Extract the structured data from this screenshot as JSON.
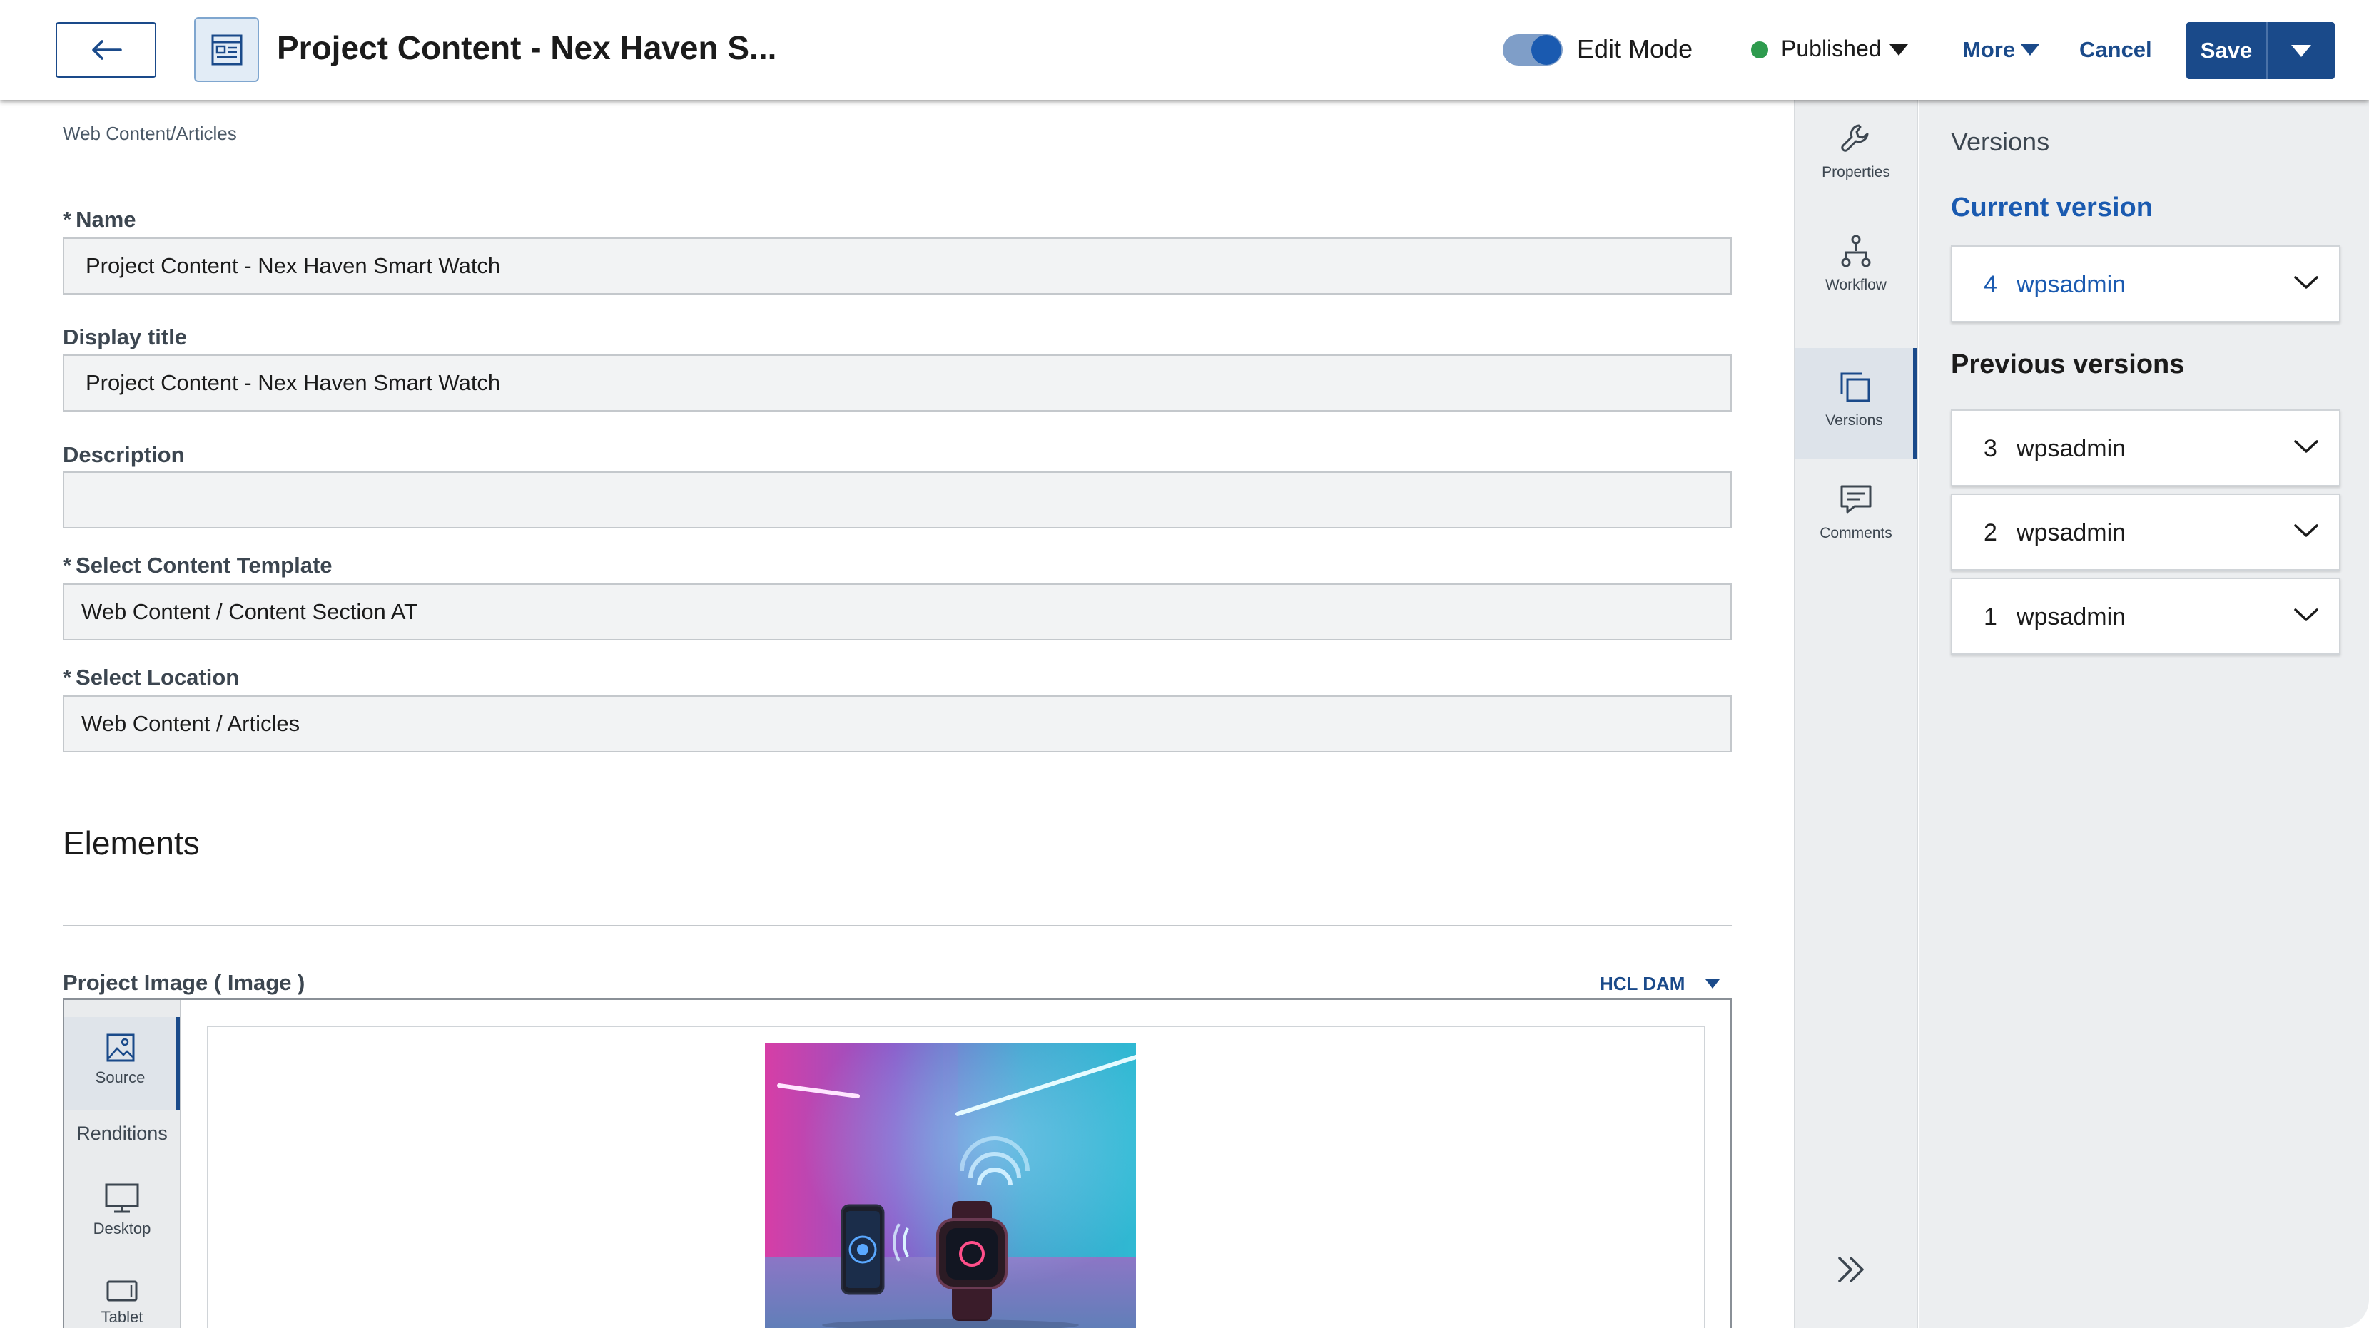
{
  "header": {
    "title": "Project Content - Nex Haven S...",
    "edit_mode_label": "Edit Mode",
    "status_label": "Published",
    "more_label": "More",
    "cancel_label": "Cancel",
    "save_label": "Save",
    "status_color": "#2e9b4e",
    "accent_color": "#1a4a8a"
  },
  "breadcrumb": "Web Content/Articles",
  "form": {
    "name": {
      "required": "*",
      "label": "Name",
      "value": "Project Content - Nex Haven Smart Watch"
    },
    "display_title": {
      "label": "Display title",
      "value": "Project Content - Nex Haven Smart Watch"
    },
    "description": {
      "label": "Description",
      "value": ""
    },
    "template": {
      "required": "*",
      "label": "Select Content Template",
      "value": "Web Content / Content Section AT"
    },
    "location": {
      "required": "*",
      "label": "Select Location",
      "value": "Web Content / Articles"
    }
  },
  "elements": {
    "heading": "Elements",
    "image_label": "Project Image ( Image )",
    "source_label": "HCL DAM",
    "renditions": [
      {
        "label": "Source",
        "icon": "image-icon"
      },
      {
        "label": "Renditions",
        "icon": ""
      },
      {
        "label": "Desktop",
        "icon": "desktop-icon"
      },
      {
        "label": "Tablet",
        "icon": "tablet-icon"
      }
    ]
  },
  "rail": {
    "items": [
      {
        "label": "Properties",
        "icon": "wrench-icon"
      },
      {
        "label": "Workflow",
        "icon": "workflow-icon"
      },
      {
        "label": "Versions",
        "icon": "versions-icon"
      },
      {
        "label": "Comments",
        "icon": "comments-icon"
      }
    ]
  },
  "versions": {
    "title": "Versions",
    "current_heading": "Current version",
    "previous_heading": "Previous versions",
    "current": {
      "number": "4",
      "user": "wpsadmin"
    },
    "previous": [
      {
        "number": "3",
        "user": "wpsadmin"
      },
      {
        "number": "2",
        "user": "wpsadmin"
      },
      {
        "number": "1",
        "user": "wpsadmin"
      }
    ]
  }
}
